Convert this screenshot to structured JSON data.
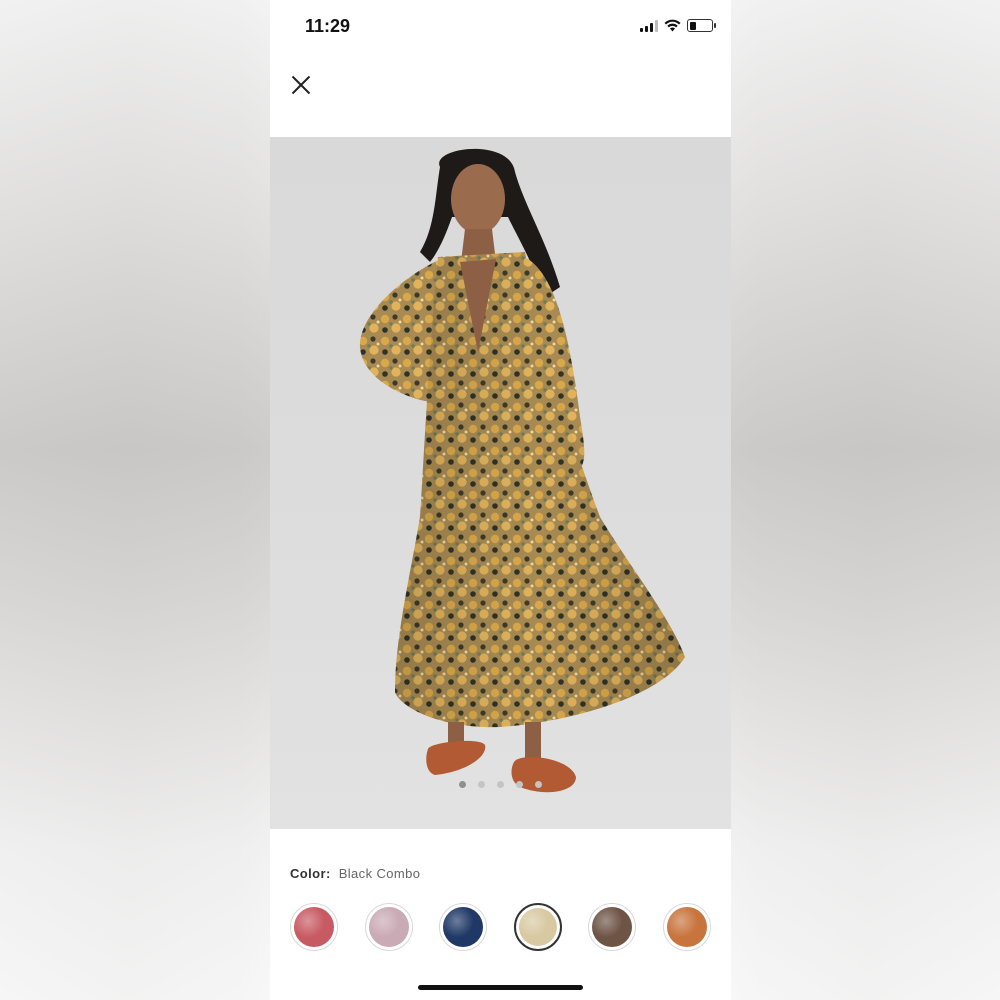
{
  "status_bar": {
    "time": "11:29",
    "signal_icon": "cellular-signal-icon",
    "wifi_icon": "wifi-icon",
    "battery_icon": "battery-icon",
    "battery_level": 0.3
  },
  "header": {
    "close_icon": "close-icon"
  },
  "product_image": {
    "description_icon": "product-photo",
    "carousel_page_count": 5,
    "carousel_active_index": 0
  },
  "color_selector": {
    "label": "Color:",
    "selected_value": "Black Combo",
    "swatches": [
      {
        "name": "red-print",
        "color": "#c85a63"
      },
      {
        "name": "lavender-print",
        "color": "#c9aab5"
      },
      {
        "name": "navy-print",
        "color": "#1f3866"
      },
      {
        "name": "black-combo",
        "color": "#d8c9a2",
        "selected": true
      },
      {
        "name": "brown-print",
        "color": "#6d5445"
      },
      {
        "name": "orange-print",
        "color": "#c8743d"
      }
    ]
  },
  "colors": {
    "background": "#ffffff",
    "text_primary": "#333333",
    "text_secondary": "#666666"
  }
}
